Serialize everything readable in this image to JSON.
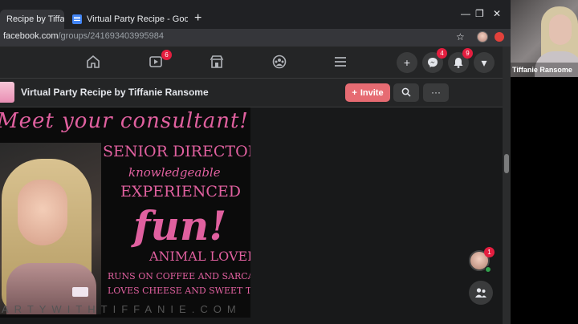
{
  "browser": {
    "tabs": [
      {
        "title": "Recipe by Tiffani",
        "active": true
      },
      {
        "title": "Virtual Party Recipe - Google Do",
        "active": false
      }
    ],
    "close_glyph": "✕",
    "new_tab_glyph": "+",
    "window_controls": [
      "—",
      "❐",
      "✕"
    ],
    "url_host": "facebook.com",
    "url_path": "/groups/241693403995984",
    "bookmark_star": "☆"
  },
  "fb_nav": {
    "icons": [
      "home-icon",
      "watch-icon",
      "marketplace-icon",
      "groups-icon",
      "menu-icon"
    ],
    "watch_badge": "6",
    "create_glyph": "+",
    "messenger_badge": "4",
    "notifications_badge": "9",
    "account_glyph": "▾"
  },
  "group": {
    "title": "Virtual Party Recipe by Tiffanie Ransome",
    "invite_label": "Invite",
    "invite_glyph": "+",
    "more_glyph": "···"
  },
  "poster": {
    "heading": "Meet your consultant!",
    "lines": [
      "Senior Director",
      "knowledgeable",
      "Experienced",
      "fun!",
      "Animal Lover",
      "Runs on coffee and sarcasm",
      "Loves cheese and sweet tea"
    ],
    "footer": "ARTYWITHTIFFANIE.COM"
  },
  "chat": {
    "badge": "1"
  },
  "webcam": {
    "name": "Tiffanie Ransome"
  },
  "colors": {
    "accent_pink": "#e0609f",
    "invite_bg": "#e66b72",
    "badge_red": "#e41e3f"
  }
}
